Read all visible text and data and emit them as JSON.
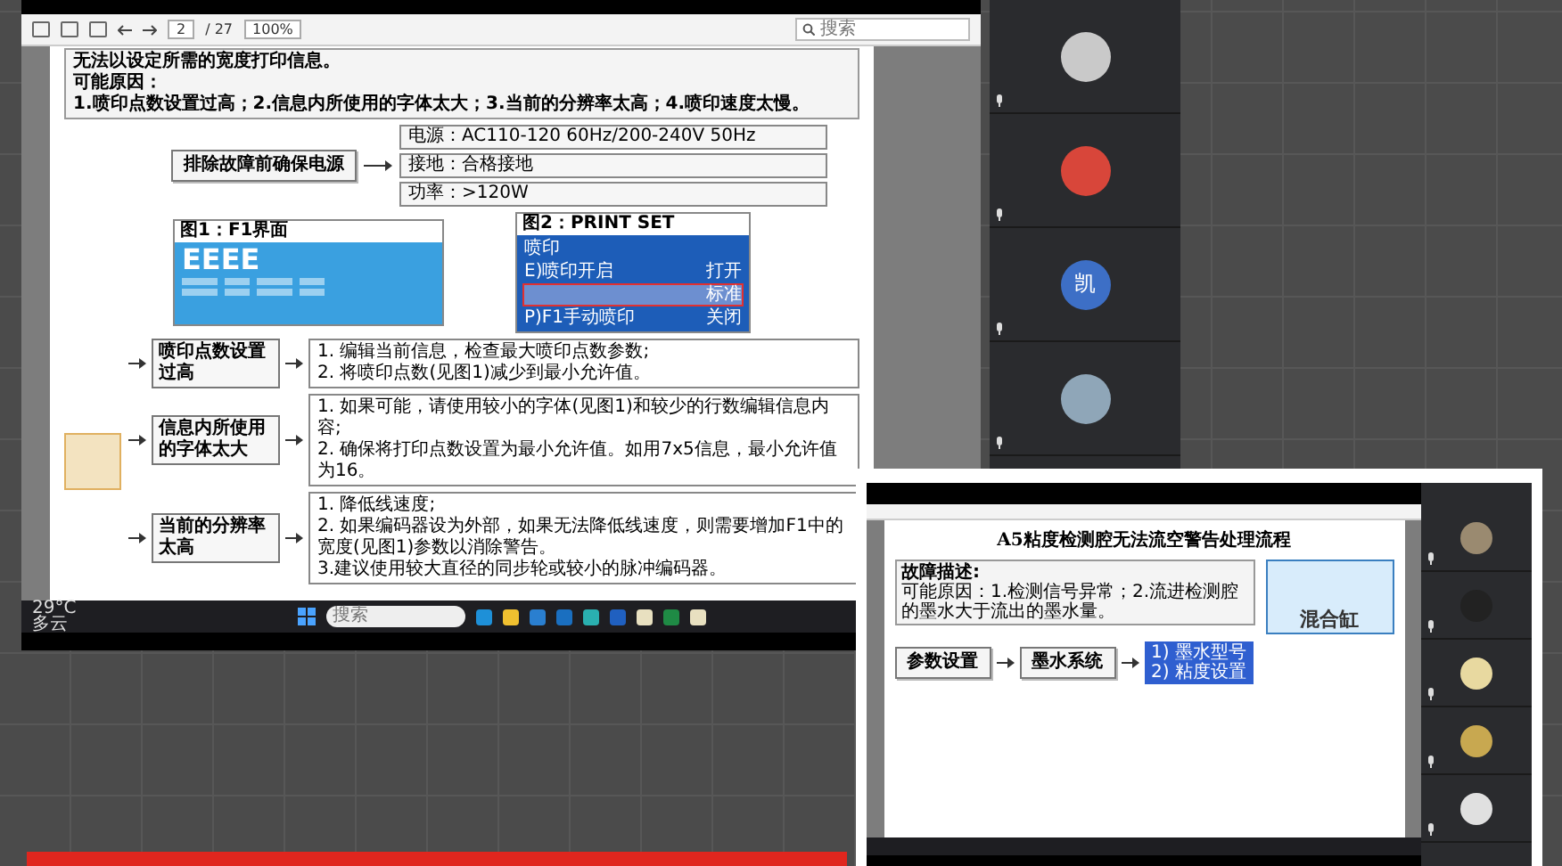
{
  "main_share": {
    "viewer": {
      "zoom": "100%",
      "page": "2",
      "page_count": "/ 27",
      "search_placeholder": "搜索"
    },
    "document": {
      "intro": [
        "无法以设定所需的宽度打印信息。",
        "可能原因：",
        "1.喷印点数设置过高；2.信息内所使用的字体太大；3.当前的分辨率太高；4.喷印速度太慢。"
      ],
      "power_check": {
        "label": "排除故障前确保电源",
        "items": [
          "电源：AC110-120 60Hz/200-240V 50Hz",
          "接地：合格接地",
          "功率：>120W"
        ]
      },
      "figures": [
        {
          "kind": "screen",
          "title": "图1：F1界面",
          "display": "EEEE"
        },
        {
          "kind": "menu",
          "title": "图2：PRINT SET",
          "section": "喷印",
          "rows": [
            {
              "label": "E)喷印开启",
              "value": "打开",
              "selected": false
            },
            {
              "label": "",
              "value": "标准",
              "selected": true
            },
            {
              "label": "P)F1手动喷印",
              "value": "关闭",
              "selected": false
            }
          ]
        }
      ],
      "causes": [
        {
          "label": "喷印点数设置过高",
          "remedies": [
            "1. 编辑当前信息，检查最大喷印点数参数;",
            "2. 将喷印点数(见图1)减少到最小允许值。"
          ]
        },
        {
          "label": "信息内所使用的字体太大",
          "remedies": [
            "1. 如果可能，请使用较小的字体(见图1)和较少的行数编辑信息内容;",
            "2. 确保将打印点数设置为最小允许值。如用7x5信息，最小允许值为16。"
          ]
        },
        {
          "label": "当前的分辨率太高",
          "remedies": [
            "1. 降低线速度;",
            "2. 如果编码器设为外部，如果无法降低线速度，则需要增加F1中的宽度(见图1)参数以消除警告。",
            "3.建议使用较大直径的同步轮或较小的脉冲编码器。"
          ]
        }
      ]
    },
    "taskbar": {
      "temperature": "29°C",
      "weather": "多云",
      "search_placeholder": "搜索"
    }
  },
  "participants": [
    {
      "kind": "photo",
      "color": "#c9c9c9"
    },
    {
      "kind": "photo",
      "color": "#d8463a"
    },
    {
      "kind": "letter",
      "letter": "凯",
      "color": "#3d6fc6"
    },
    {
      "kind": "photo",
      "color": "#8fa6b8"
    }
  ],
  "second_share": {
    "title": "A5粘度检测腔无法流空警告处理流程",
    "fault_label": "故障描述:",
    "fault_cause": "可能原因：1.检测信号异常；2.流进检测腔的墨水大于流出的墨水量。",
    "tank_label": "混合缸",
    "steps": [
      "参数设置",
      "墨水系统"
    ],
    "menu_items": [
      "1) 墨水型号",
      "2) 粘度设置"
    ],
    "participants": [
      {
        "kind": "photo",
        "color": "#9a8a70"
      },
      {
        "kind": "photo",
        "color": "#222222"
      },
      {
        "kind": "photo",
        "color": "#e8d9a0"
      },
      {
        "kind": "photo",
        "color": "#c8a850"
      },
      {
        "kind": "photo",
        "color": "#e0e0e0"
      }
    ]
  }
}
